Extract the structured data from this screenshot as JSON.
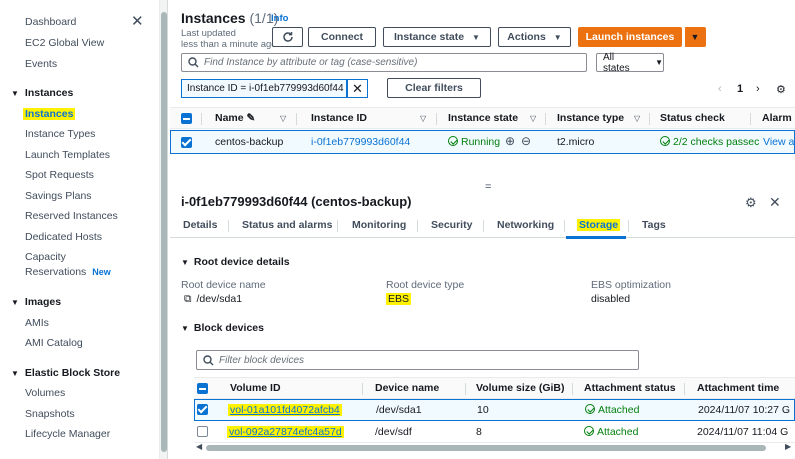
{
  "sidebar": {
    "top_items": [
      "Dashboard",
      "EC2 Global View",
      "Events"
    ],
    "instances_section": {
      "title": "Instances",
      "items": [
        "Instances",
        "Instance Types",
        "Launch Templates",
        "Spot Requests",
        "Savings Plans",
        "Reserved Instances",
        "Dedicated Hosts",
        "Capacity",
        "Reservations"
      ],
      "new_badge": "New"
    },
    "images_section": {
      "title": "Images",
      "items": [
        "AMIs",
        "AMI Catalog"
      ]
    },
    "ebs_section": {
      "title": "Elastic Block Store",
      "items": [
        "Volumes",
        "Snapshots",
        "Lifecycle Manager"
      ]
    }
  },
  "header": {
    "title": "Instances",
    "count": "(1/1)",
    "info": "Info",
    "last_updated_label": "Last updated",
    "last_updated_value": "less than a minute ago",
    "connect": "Connect",
    "instance_state": "Instance state",
    "actions": "Actions",
    "launch": "Launch instances",
    "search_placeholder": "Find Instance by attribute or tag (case-sensitive)",
    "states_filter": "All states",
    "filter_chip": "Instance ID = i-0f1eb779993d60f44",
    "clear_filters": "Clear filters",
    "page": "1"
  },
  "instances_table": {
    "columns": [
      "Name",
      "Instance ID",
      "Instance state",
      "Instance type",
      "Status check",
      "Alarm s"
    ],
    "row": {
      "name": "centos-backup",
      "instance_id": "i-0f1eb779993d60f44",
      "state": "Running",
      "type": "t2.micro",
      "status_check": "2/2 checks passec",
      "alarm": "View al"
    }
  },
  "details": {
    "title": "i-0f1eb779993d60f44 (centos-backup)",
    "tabs": [
      "Details",
      "Status and alarms",
      "Monitoring",
      "Security",
      "Networking",
      "Storage",
      "Tags"
    ],
    "root_section": "Root device details",
    "root_device_name_label": "Root device name",
    "root_device_name": "/dev/sda1",
    "root_device_type_label": "Root device type",
    "root_device_type": "EBS",
    "ebs_opt_label": "EBS optimization",
    "ebs_opt_value": "disabled",
    "block_section": "Block devices",
    "block_search_placeholder": "Filter block devices"
  },
  "block_devices": {
    "columns": [
      "Volume ID",
      "Device name",
      "Volume size (GiB)",
      "Attachment status",
      "Attachment time"
    ],
    "rows": [
      {
        "volume_id": "vol-01a101fd4072afcb4",
        "device": "/dev/sda1",
        "size": "10",
        "status": "Attached",
        "time": "2024/11/07 10:27 G"
      },
      {
        "volume_id": "vol-092a27874efc4a57d",
        "device": "/dev/sdf",
        "size": "8",
        "status": "Attached",
        "time": "2024/11/07 11:04 G"
      }
    ]
  },
  "colors": {
    "accent": "#0972d3",
    "orange": "#ec7211",
    "success": "#037f0c",
    "highlight": "#fff200"
  }
}
